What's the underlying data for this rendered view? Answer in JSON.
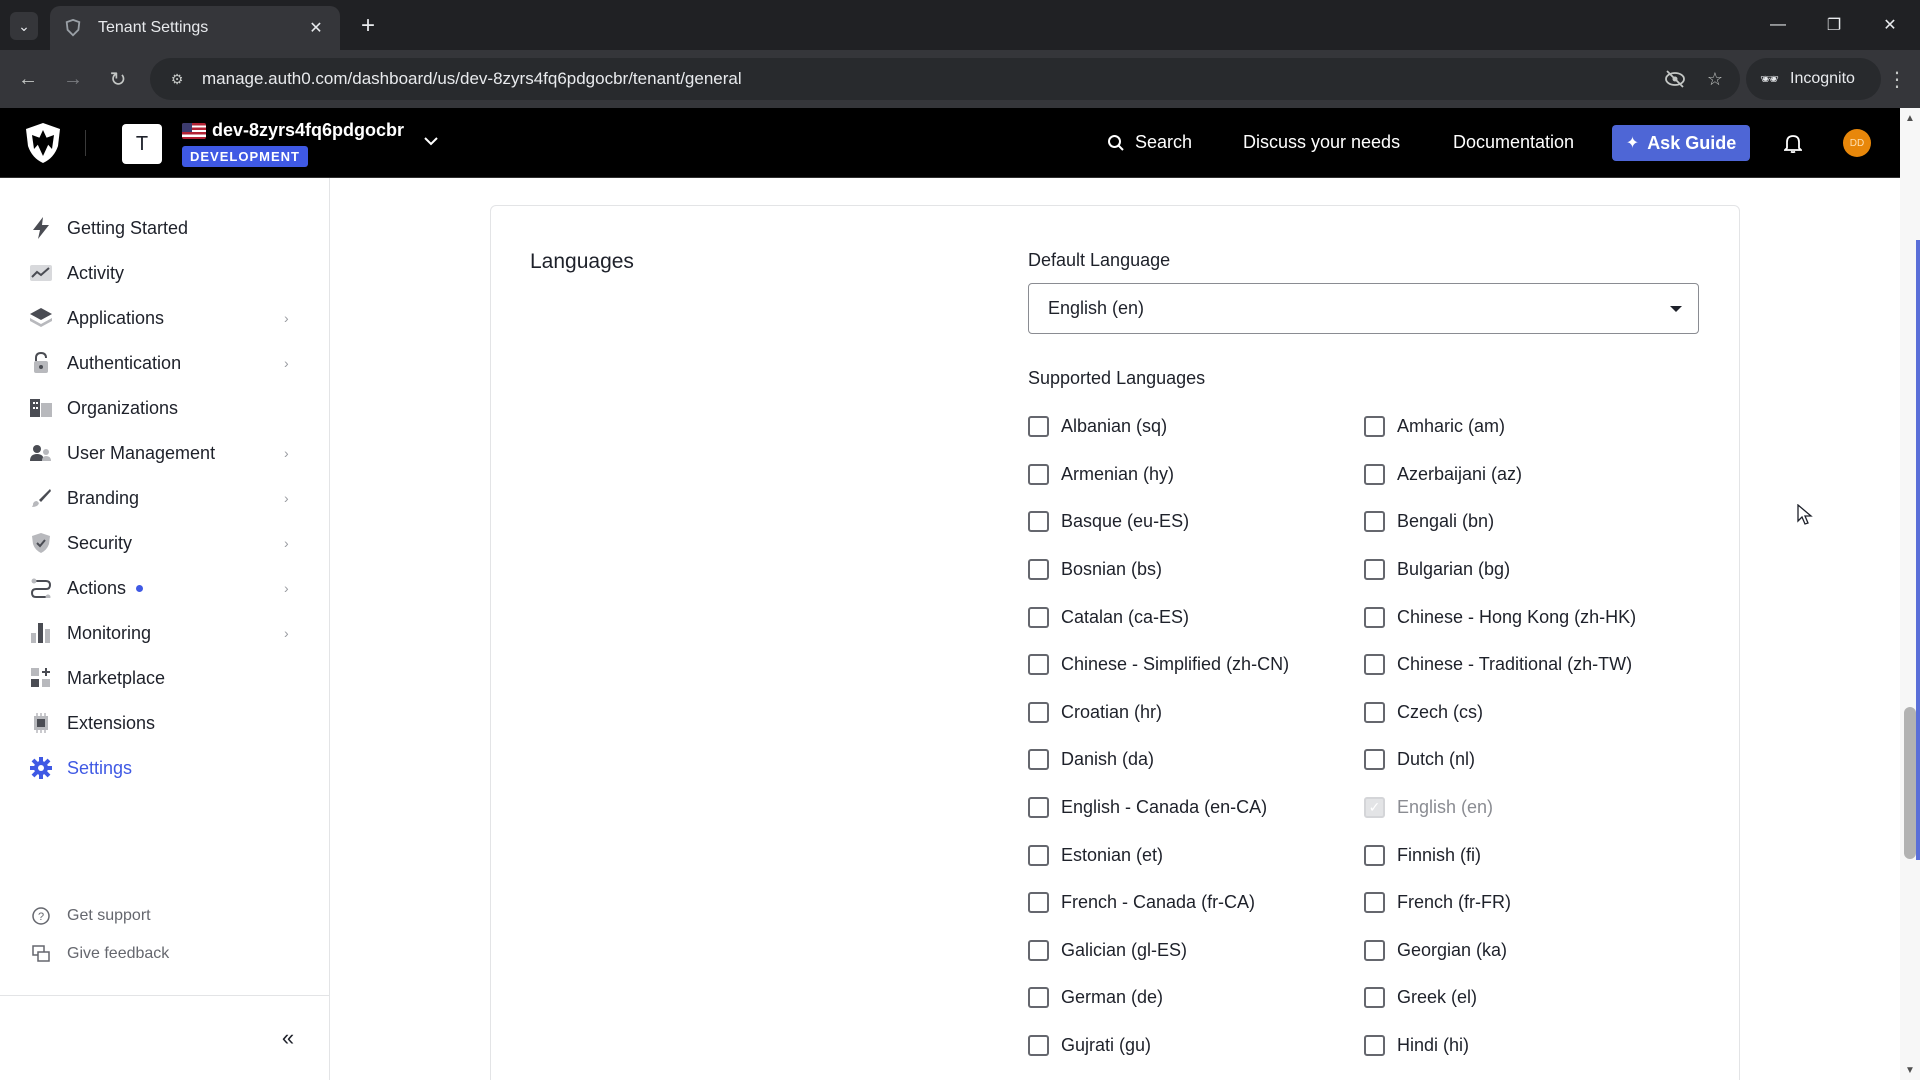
{
  "browser": {
    "tab_title": "Tenant Settings",
    "url": "manage.auth0.com/dashboard/us/dev-8zyrs4fq6pdgocbr/tenant/general",
    "incognito_label": "Incognito"
  },
  "header": {
    "tenant_initial": "T",
    "tenant_name": "dev-8zyrs4fq6pdgocbr",
    "environment": "DEVELOPMENT",
    "search_label": "Search",
    "discuss_label": "Discuss your needs",
    "docs_label": "Documentation",
    "ask_guide_label": "Ask Guide",
    "user_initials": "DD"
  },
  "sidebar": {
    "items": [
      {
        "label": "Getting Started"
      },
      {
        "label": "Activity"
      },
      {
        "label": "Applications"
      },
      {
        "label": "Authentication"
      },
      {
        "label": "Organizations"
      },
      {
        "label": "User Management"
      },
      {
        "label": "Branding"
      },
      {
        "label": "Security"
      },
      {
        "label": "Actions"
      },
      {
        "label": "Monitoring"
      },
      {
        "label": "Marketplace"
      },
      {
        "label": "Extensions"
      },
      {
        "label": "Settings"
      }
    ],
    "support_label": "Get support",
    "feedback_label": "Give feedback"
  },
  "main": {
    "section_title": "Languages",
    "default_language_label": "Default Language",
    "default_language_value": "English (en)",
    "supported_languages_label": "Supported Languages",
    "languages": [
      {
        "label": "Albanian (sq)",
        "checked": false,
        "disabled": false
      },
      {
        "label": "Amharic (am)",
        "checked": false,
        "disabled": false
      },
      {
        "label": "Armenian (hy)",
        "checked": false,
        "disabled": false
      },
      {
        "label": "Azerbaijani (az)",
        "checked": false,
        "disabled": false
      },
      {
        "label": "Basque (eu-ES)",
        "checked": false,
        "disabled": false
      },
      {
        "label": "Bengali (bn)",
        "checked": false,
        "disabled": false
      },
      {
        "label": "Bosnian (bs)",
        "checked": false,
        "disabled": false
      },
      {
        "label": "Bulgarian (bg)",
        "checked": false,
        "disabled": false
      },
      {
        "label": "Catalan (ca-ES)",
        "checked": false,
        "disabled": false
      },
      {
        "label": "Chinese - Hong Kong (zh-HK)",
        "checked": false,
        "disabled": false
      },
      {
        "label": "Chinese - Simplified (zh-CN)",
        "checked": false,
        "disabled": false
      },
      {
        "label": "Chinese - Traditional (zh-TW)",
        "checked": false,
        "disabled": false
      },
      {
        "label": "Croatian (hr)",
        "checked": false,
        "disabled": false
      },
      {
        "label": "Czech (cs)",
        "checked": false,
        "disabled": false
      },
      {
        "label": "Danish (da)",
        "checked": false,
        "disabled": false
      },
      {
        "label": "Dutch (nl)",
        "checked": false,
        "disabled": false
      },
      {
        "label": "English - Canada (en-CA)",
        "checked": false,
        "disabled": false
      },
      {
        "label": "English (en)",
        "checked": true,
        "disabled": true
      },
      {
        "label": "Estonian (et)",
        "checked": false,
        "disabled": false
      },
      {
        "label": "Finnish (fi)",
        "checked": false,
        "disabled": false
      },
      {
        "label": "French - Canada (fr-CA)",
        "checked": false,
        "disabled": false
      },
      {
        "label": "French (fr-FR)",
        "checked": false,
        "disabled": false
      },
      {
        "label": "Galician (gl-ES)",
        "checked": false,
        "disabled": false
      },
      {
        "label": "Georgian (ka)",
        "checked": false,
        "disabled": false
      },
      {
        "label": "German (de)",
        "checked": false,
        "disabled": false
      },
      {
        "label": "Greek (el)",
        "checked": false,
        "disabled": false
      },
      {
        "label": "Gujrati (gu)",
        "checked": false,
        "disabled": false
      },
      {
        "label": "Hindi (hi)",
        "checked": false,
        "disabled": false
      }
    ]
  },
  "colors": {
    "accent": "#3f59e4",
    "ask_guide_bg": "#4e66d6",
    "header_bg": "#000000",
    "avatar_bg": "#e8870a"
  }
}
